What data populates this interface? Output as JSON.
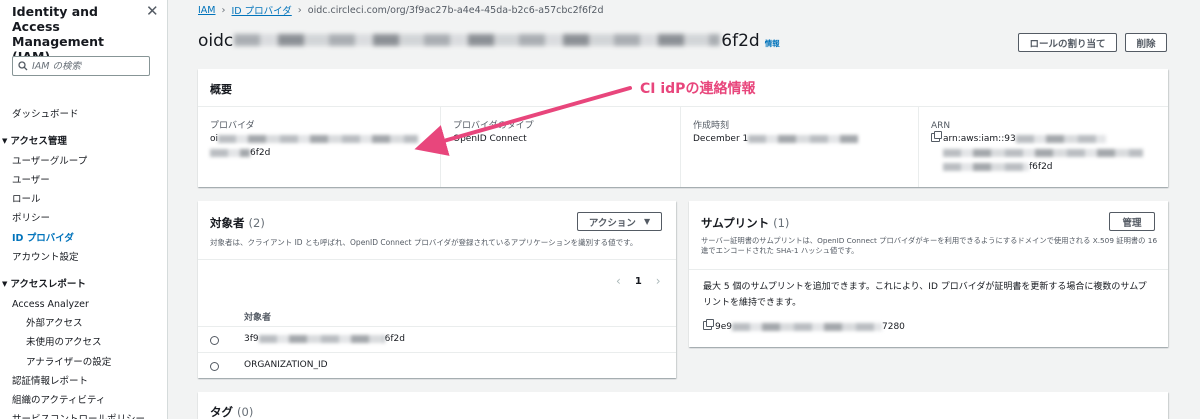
{
  "sidebar": {
    "title": "Identity and Access Management (IAM)",
    "search_placeholder": "IAM の検索",
    "items": [
      {
        "label": "ダッシュボード"
      },
      {
        "label": "アクセス管理"
      },
      {
        "label": "ユーザーグループ"
      },
      {
        "label": "ユーザー"
      },
      {
        "label": "ロール"
      },
      {
        "label": "ポリシー"
      },
      {
        "label": "ID プロバイダ"
      },
      {
        "label": "アカウント設定"
      },
      {
        "label": "アクセスレポート"
      },
      {
        "label": "Access Analyzer"
      },
      {
        "label": "外部アクセス"
      },
      {
        "label": "未使用のアクセス"
      },
      {
        "label": "アナライザーの設定"
      },
      {
        "label": "認証情報レポート"
      },
      {
        "label": "組織のアクティビティ"
      },
      {
        "label": "サービスコントロールポリシー"
      }
    ]
  },
  "breadcrumb": {
    "root": "IAM",
    "section": "ID プロバイダ",
    "current": "oidc.circleci.com/org/3f9ac27b-a4e4-45da-b2c6-a57cbc2f6f2d"
  },
  "header": {
    "title_prefix": "oidc",
    "title_suffix": "6f2d",
    "info_link": "情報",
    "assign_role_button": "ロールの割り当て",
    "delete_button": "削除"
  },
  "summary": {
    "title": "概要",
    "provider_label": "プロバイダ",
    "provider_value_prefix": "oi",
    "provider_value_line2_suffix": "6f2d",
    "provider_type_label": "プロバイダのタイプ",
    "provider_type_value": "OpenID Connect",
    "created_label": "作成時刻",
    "created_value_prefix": "December 1",
    "arn_label": "ARN",
    "arn_value_prefix": "arn:aws:iam::93",
    "arn_value_suffix": "f6f2d"
  },
  "annotation": {
    "text": "CI idPの連絡情報",
    "color": "#e8467c"
  },
  "audiences": {
    "title": "対象者",
    "count": "(2)",
    "description": "対象者は、クライアント ID とも呼ばれ、OpenID Connect プロバイダが登録されているアプリケーションを識別する値です。",
    "action_button": "アクション",
    "page": "1",
    "column_header": "対象者",
    "rows": [
      {
        "prefix": "3f9",
        "suffix": "6f2d"
      },
      {
        "value": "ORGANIZATION_ID"
      }
    ]
  },
  "thumbprints": {
    "title": "サムプリント",
    "count": "(1)",
    "manage_button": "管理",
    "description": "サーバー証明書のサムプリントは、OpenID Connect プロバイダがキーを利用できるようにするドメインで使用される X.509 証明書の 16 進でエンコードされた SHA-1 ハッシュ値です。",
    "body": "最大 5 個のサムプリントを追加できます。これにより、ID プロバイダが証明書を更新する場合に複数のサムプリントを維持できます。",
    "fingerprint_prefix": "9e9",
    "fingerprint_suffix": "7280"
  },
  "tags": {
    "title": "タグ",
    "count": "(0)"
  },
  "colors": {
    "link": "#0073bb",
    "background": "#f2f3f3",
    "text": "#16191f"
  }
}
